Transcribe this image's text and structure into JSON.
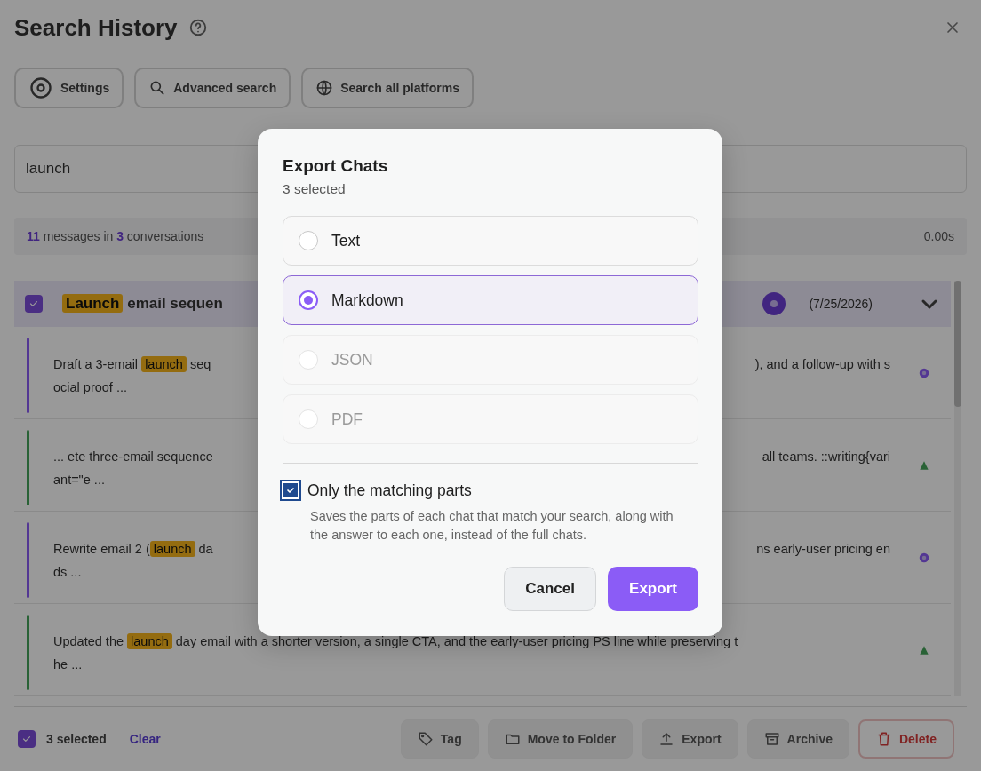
{
  "history": {
    "title": "Search History",
    "toolbar": [
      {
        "label": "Settings",
        "kind": "settings"
      },
      {
        "label": "Advanced search",
        "kind": "search"
      },
      {
        "label": "Search all platforms",
        "kind": "globe"
      }
    ],
    "search": {
      "value": "launch"
    },
    "stats": {
      "summary": [
        {
          "text": "11",
          "kind": "count"
        },
        {
          "text": " messages in ",
          "kind": "plain"
        },
        {
          "text": "3",
          "kind": "count"
        },
        {
          "text": " conversations",
          "kind": "plain"
        }
      ],
      "time": "0.00s"
    },
    "conversation": {
      "checked": true,
      "expanded": true,
      "title": [
        {
          "text": "Launch",
          "kind": "highlight"
        },
        {
          "text": " email sequen",
          "kind": "plain"
        }
      ],
      "date": "(7/25/2026)",
      "messages": [
        {
          "kind": "user",
          "first": [
            {
              "text": "Draft a 3-email ",
              "kind": "plain"
            },
            {
              "text": "launch",
              "kind": "highlight"
            },
            {
              "text": " seq",
              "kind": "plain"
            }
          ],
          "tail": "), and a follow-up with s",
          "second": "ocial proof ..."
        },
        {
          "kind": "assistant",
          "first": [
            {
              "text": "... ete three-email sequence",
              "kind": "plain"
            }
          ],
          "tail": "all teams. ::writing{vari",
          "second": "ant=\"e ..."
        },
        {
          "kind": "user",
          "first": [
            {
              "text": "Rewrite email 2 (",
              "kind": "plain"
            },
            {
              "text": "launch",
              "kind": "highlight"
            },
            {
              "text": " da",
              "kind": "plain"
            }
          ],
          "tail": "ns early-user pricing en",
          "second": "ds ..."
        },
        {
          "kind": "assistant",
          "first": [
            {
              "text": "Updated the ",
              "kind": "plain"
            },
            {
              "text": "launch",
              "kind": "highlight"
            },
            {
              "text": " day email with a shorter version, a single CTA, and the early-user pricing PS line while preserving t",
              "kind": "plain"
            }
          ],
          "second": "he ..."
        }
      ]
    },
    "selection": {
      "checked": true,
      "count": "3 selected",
      "clear": "Clear",
      "actions": [
        {
          "label": "Tag",
          "kind": "tag"
        },
        {
          "label": "Move to Folder",
          "kind": "folder"
        },
        {
          "label": "Export",
          "kind": "export"
        },
        {
          "label": "Archive",
          "kind": "archive"
        },
        {
          "label": "Delete",
          "kind": "delete"
        }
      ]
    }
  },
  "dialog": {
    "title": "Export Chats",
    "subtitle": "3 selected",
    "formats": [
      {
        "label": "Text",
        "selected": false,
        "disabled": false
      },
      {
        "label": "Markdown",
        "selected": true,
        "disabled": false
      },
      {
        "label": "JSON",
        "selected": false,
        "disabled": true
      },
      {
        "label": "PDF",
        "selected": false,
        "disabled": true
      }
    ],
    "option": {
      "label": "Only the matching parts",
      "checked": true,
      "description": "Saves the parts of each chat that match your search, along with the answer to each one, instead of the full chats."
    },
    "buttons": [
      {
        "label": "Cancel",
        "kind": "secondary"
      },
      {
        "label": "Export",
        "kind": "primary"
      }
    ]
  }
}
